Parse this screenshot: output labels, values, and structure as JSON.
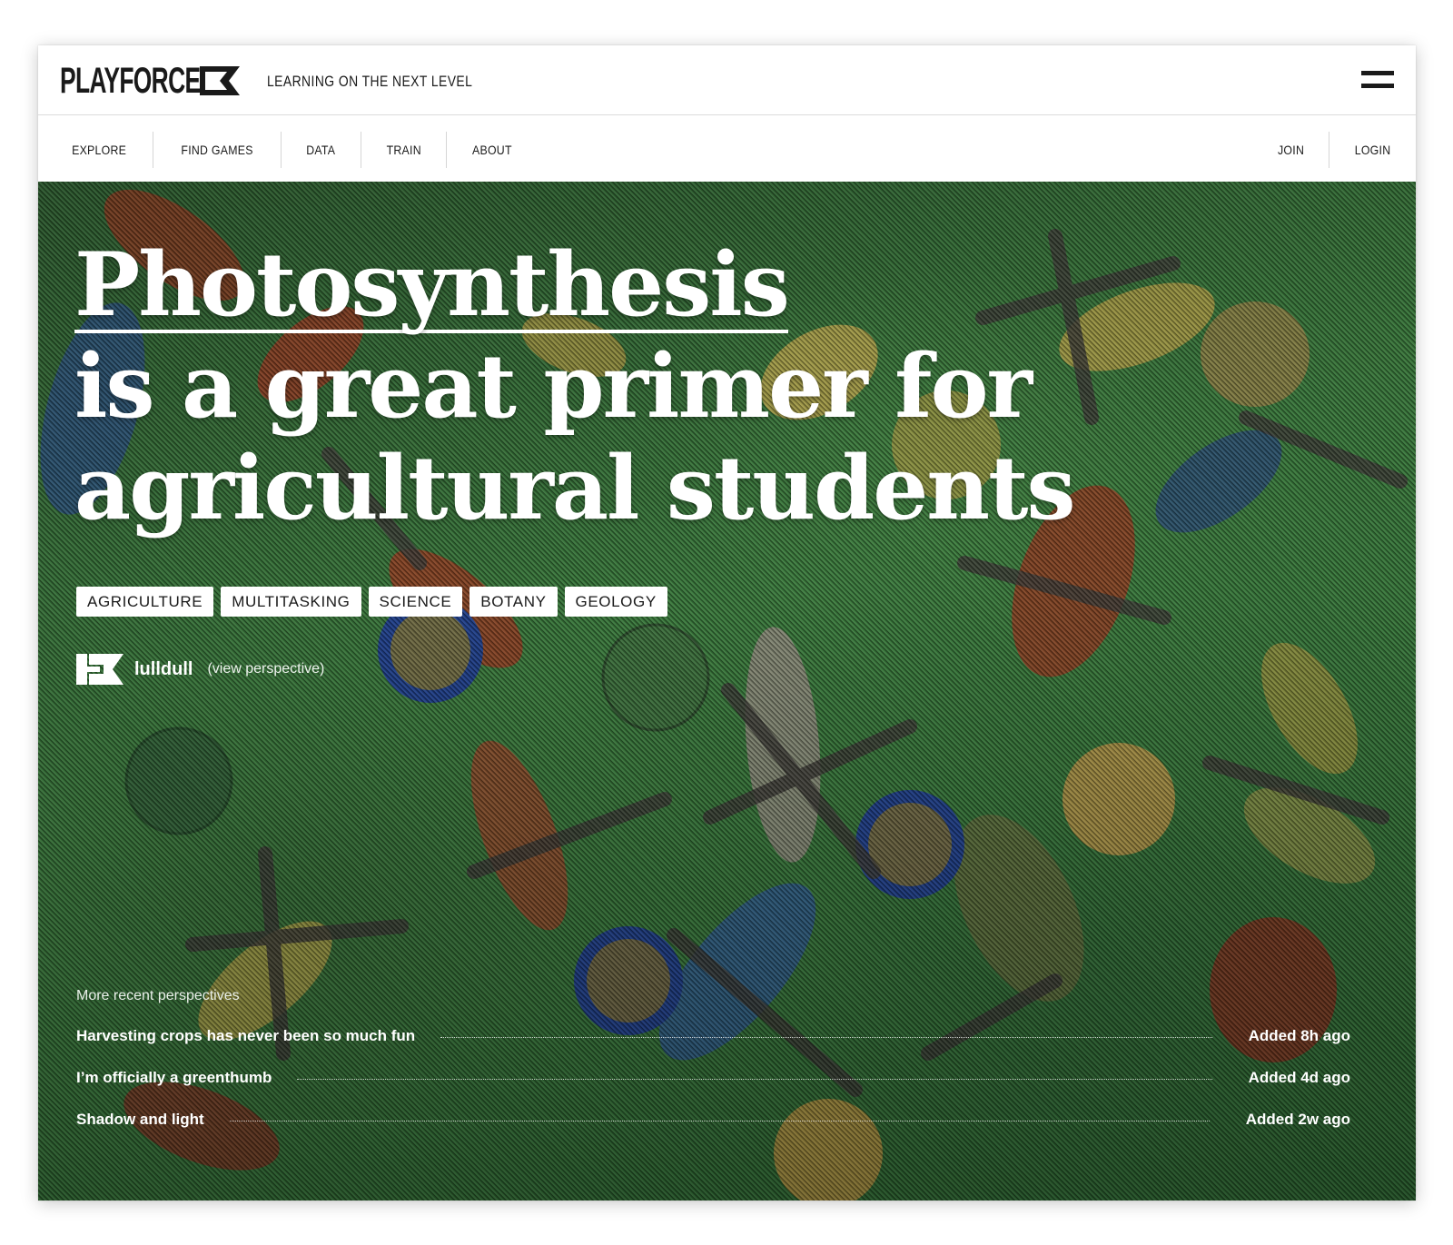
{
  "header": {
    "logo_text": "PLAYFORCE",
    "tagline": "LEARNING ON THE NEXT LEVEL"
  },
  "nav": {
    "left": [
      "EXPLORE",
      "FIND GAMES",
      "DATA",
      "TRAIN",
      "ABOUT"
    ],
    "right": [
      "JOIN",
      "LOGIN"
    ]
  },
  "hero": {
    "headline_link": "Photosynthesis",
    "headline_line2": "is a great primer for",
    "headline_line3": "agricultural students",
    "tags": [
      "AGRICULTURE",
      "MULTITASKING",
      "SCIENCE",
      "BOTANY",
      "GEOLOGY"
    ],
    "author": {
      "name": "lulldull",
      "link": "(view perspective)"
    }
  },
  "recent": {
    "heading": "More recent perspectives",
    "items": [
      {
        "title": "Harvesting crops has never been so much fun",
        "time": "Added 8h ago"
      },
      {
        "title": "I’m officially a greenthumb",
        "time": "Added 4d ago"
      },
      {
        "title": "Shadow and light",
        "time": "Added 2w ago"
      }
    ]
  },
  "colors": {
    "hero_green": "#2e6b33",
    "text_dark": "#1a1a1a",
    "white": "#ffffff"
  },
  "icons": [
    "logo-flag-icon",
    "menu-icon",
    "author-avatar-icon"
  ]
}
